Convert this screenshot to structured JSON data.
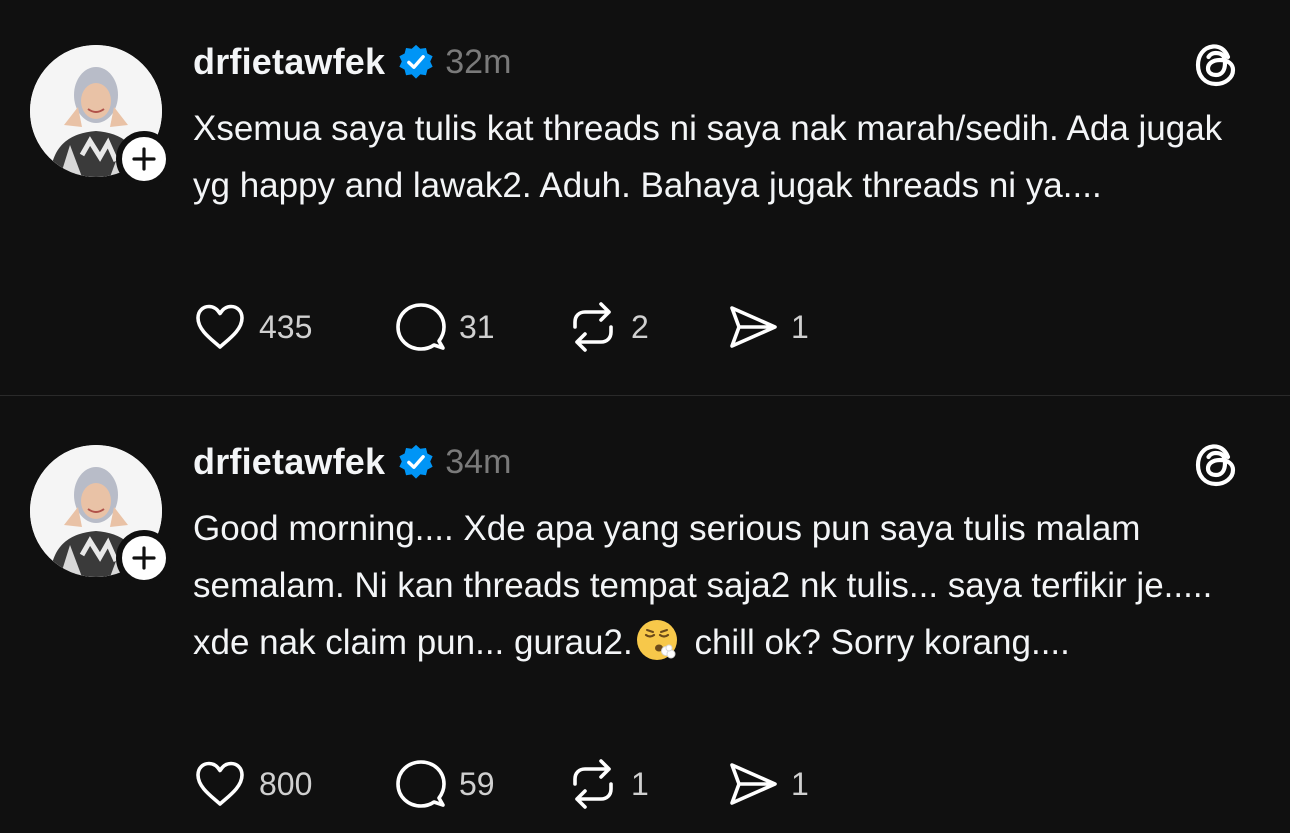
{
  "posts": [
    {
      "username": "drfietawfek",
      "time": "32m",
      "text": "Xsemua saya tulis kat threads ni saya nak marah/sedih. Ada jugak yg happy and lawak2. Aduh. Bahaya jugak threads ni ya....",
      "likes": "435",
      "replies": "31",
      "reposts": "2",
      "shares": "1"
    },
    {
      "username": "drfietawfek",
      "time": "34m",
      "text_before_emoji": "Good morning.... Xde apa yang serious pun saya tulis malam semalam. Ni kan threads tempat saja2 nk tulis... saya terfikir je..... xde nak claim pun... gurau2.",
      "text_after_emoji": " chill ok? Sorry korang....",
      "emoji": "exhaling-face-emoji",
      "likes": "800",
      "replies": "59",
      "reposts": "1",
      "shares": "1"
    }
  ],
  "colors": {
    "background": "#101010",
    "text": "#f3f5f7",
    "muted": "#7a7a7a",
    "verified": "#0095f6",
    "divider": "#2a2a2a"
  }
}
